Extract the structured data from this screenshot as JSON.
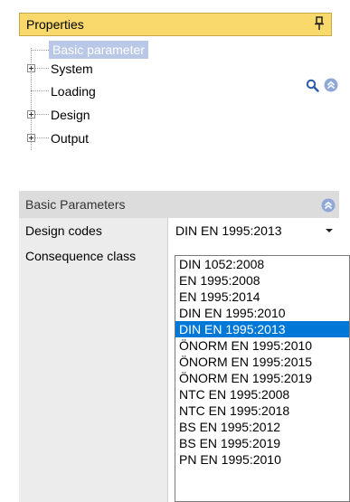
{
  "properties": {
    "title": "Properties",
    "pin_icon": "pin-icon"
  },
  "tree": {
    "items": [
      {
        "label": "Basic parameter",
        "selected": true
      },
      {
        "label": "System",
        "expandable": true
      },
      {
        "label": "Loading"
      },
      {
        "label": "Design",
        "expandable": true
      },
      {
        "label": "Output",
        "expandable": true
      }
    ],
    "search_icon": "search-icon",
    "collapse_icon": "chevron-up-circle-icon"
  },
  "basic_parameters": {
    "title": "Basic Parameters",
    "rows": [
      {
        "label": "Design codes",
        "value": "DIN EN 1995:2013"
      },
      {
        "label": "Consequence class",
        "value": ""
      }
    ]
  },
  "dropdown": {
    "options": [
      "DIN 1052:2008",
      "EN 1995:2008",
      "EN 1995:2014",
      "DIN EN 1995:2010",
      "DIN EN 1995:2013",
      "ÖNORM EN 1995:2010",
      "ÖNORM EN 1995:2015",
      "ÖNORM EN 1995:2019",
      "NTC EN 1995:2008",
      "NTC EN 1995:2018",
      "BS EN 1995:2012",
      "BS EN 1995:2019",
      "PN EN 1995:2010"
    ],
    "selected": "DIN EN 1995:2013"
  },
  "colors": {
    "header_accent": "#f9d96b",
    "selection": "#0078d7",
    "tree_selection": "#b9c8e6",
    "collapse_icon": "#8fa8d8"
  }
}
